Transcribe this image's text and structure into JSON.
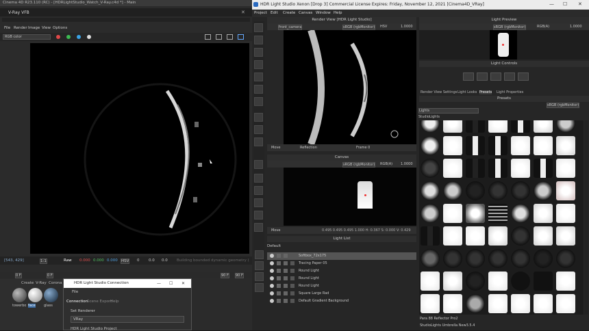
{
  "c4d": {
    "title": "Cinema 4D R23.110 (RC) - [HDRLightStudio_Watch_V-Ray.c4d *] - Main",
    "vfb_title": "V-Ray VFB",
    "menu": [
      "File",
      "Render",
      "Image",
      "View",
      "Options"
    ],
    "channel": "RGB color",
    "status": {
      "coords": "[543, 429]",
      "zoom": "1:1",
      "raw": "Raw",
      "r": "0.000",
      "g": "0.000",
      "b": "0.000",
      "mode": "HSV",
      "v1": "0",
      "v2": "0.0",
      "v3": "0.0",
      "note": "Building bounded dynamic geometry (tex..."
    },
    "timeline": {
      "a": "0 F",
      "b": "0 F",
      "c": "90 F",
      "d": "90 F"
    },
    "mat_menu": [
      "Create",
      "V-Ray",
      "Corona"
    ],
    "materials": [
      "towerbo",
      "face",
      "glass"
    ]
  },
  "conn": {
    "title": "HDR Light Studio Connection",
    "menu": "File",
    "tabs": [
      "Connection",
      "Scene Export",
      "Help"
    ],
    "set_renderer": "Set Renderer",
    "renderer": "VRay",
    "project": "HDR Light Studio Project"
  },
  "hdr": {
    "title": "HDR Light Studio Xenon [Drop 3] Commercial License Expires: Friday, November 12, 2021  [Cinema4D_VRay]",
    "menu": [
      "Project",
      "Edit",
      "Create",
      "Canvas",
      "Window",
      "Help"
    ],
    "render_view": {
      "title": "Render View [HDR Light Studio]",
      "camera": "front_camera",
      "space": "sRGB (rgbMonitor)",
      "mode": "HSV",
      "value": "1.0000",
      "move": "Move",
      "reflection": "Reflection",
      "frame": "Frame 0"
    },
    "canvas": {
      "title": "Canvas",
      "space": "sRGB (rgbMonitor)",
      "channel": "RGB(A)",
      "value": "1.0000",
      "move": "Move",
      "readout": "0.495 0.495 0.495 1.000 H: 0.367 S: 0.000 V: 0.429"
    },
    "light_list": {
      "title": "Light List",
      "preset": "Default",
      "items": [
        {
          "label": "Softbox_72x175",
          "selected": true
        },
        {
          "label": "Tracing Paper 05",
          "selected": false
        },
        {
          "label": "Round Light",
          "selected": false
        },
        {
          "label": "Round Light",
          "selected": false
        },
        {
          "label": "Round Light",
          "selected": false
        },
        {
          "label": "Square Large Rad",
          "selected": false
        },
        {
          "label": "Default Gradient Background",
          "selected": false
        }
      ]
    },
    "light_preview": {
      "title": "Light Preview",
      "space": "sRGB (rgbMonitor)",
      "channel": "RGB(A)",
      "value": "1.0000"
    },
    "light_controls": {
      "title": "Light Controls"
    },
    "tabs": [
      "Render View Settings",
      "Light Looks",
      "Presets",
      "Light Properties"
    ],
    "presets": {
      "title": "Presets",
      "space": "sRGB (rgbMonitor)",
      "category": "Lights",
      "subcat": "StudioLights",
      "selected": "Para 88 Reflector Pro2",
      "footer": "StudioLights Umbrella New3.5.4"
    }
  }
}
